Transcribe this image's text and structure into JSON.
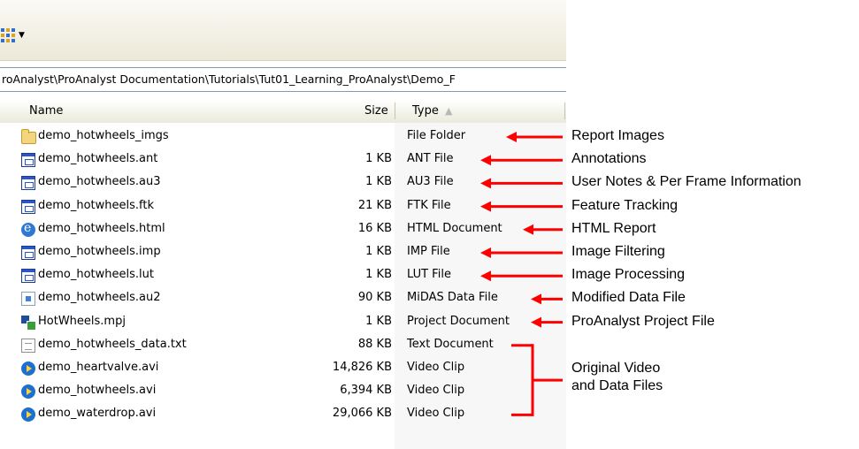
{
  "address": {
    "path": "roAnalyst\\ProAnalyst Documentation\\Tutorials\\Tut01_Learning_ProAnalyst\\Demo_F"
  },
  "columns": {
    "name": "Name",
    "size": "Size",
    "type": "Type",
    "type_sort": "ascending"
  },
  "files": [
    {
      "name": "demo_hotwheels_imgs",
      "size": "",
      "type": "File Folder",
      "icon": "folder-icon"
    },
    {
      "name": "demo_hotwheels.ant",
      "size": "1 KB",
      "type": "ANT File",
      "icon": "application-file-icon"
    },
    {
      "name": "demo_hotwheels.au3",
      "size": "1 KB",
      "type": "AU3 File",
      "icon": "application-file-icon"
    },
    {
      "name": "demo_hotwheels.ftk",
      "size": "21 KB",
      "type": "FTK File",
      "icon": "application-file-icon"
    },
    {
      "name": "demo_hotwheels.html",
      "size": "16 KB",
      "type": "HTML Document",
      "icon": "internet-explorer-icon"
    },
    {
      "name": "demo_hotwheels.imp",
      "size": "1 KB",
      "type": "IMP File",
      "icon": "application-file-icon"
    },
    {
      "name": "demo_hotwheels.lut",
      "size": "1 KB",
      "type": "LUT File",
      "icon": "application-file-icon"
    },
    {
      "name": "demo_hotwheels.au2",
      "size": "90 KB",
      "type": "MiDAS Data File",
      "icon": "midas-data-icon"
    },
    {
      "name": "HotWheels.mpj",
      "size": "1 KB",
      "type": "Project Document",
      "icon": "project-icon"
    },
    {
      "name": "demo_hotwheels_data.txt",
      "size": "88 KB",
      "type": "Text Document",
      "icon": "text-file-icon"
    },
    {
      "name": "demo_heartvalve.avi",
      "size": "14,826 KB",
      "type": "Video Clip",
      "icon": "video-clip-icon"
    },
    {
      "name": "demo_hotwheels.avi",
      "size": "6,394 KB",
      "type": "Video Clip",
      "icon": "video-clip-icon"
    },
    {
      "name": "demo_waterdrop.avi",
      "size": "29,066 KB",
      "type": "Video Clip",
      "icon": "video-clip-icon"
    }
  ],
  "annotations": [
    "Report Images",
    "Annotations",
    "User Notes & Per Frame Information",
    "Feature Tracking",
    "HTML Report",
    "Image Filtering",
    "Image Processing",
    "Modified Data File",
    "ProAnalyst Project File"
  ],
  "group_annotation": {
    "line1": "Original Video",
    "line2": "and Data Files"
  },
  "colors": {
    "arrow": "#ff0000"
  }
}
